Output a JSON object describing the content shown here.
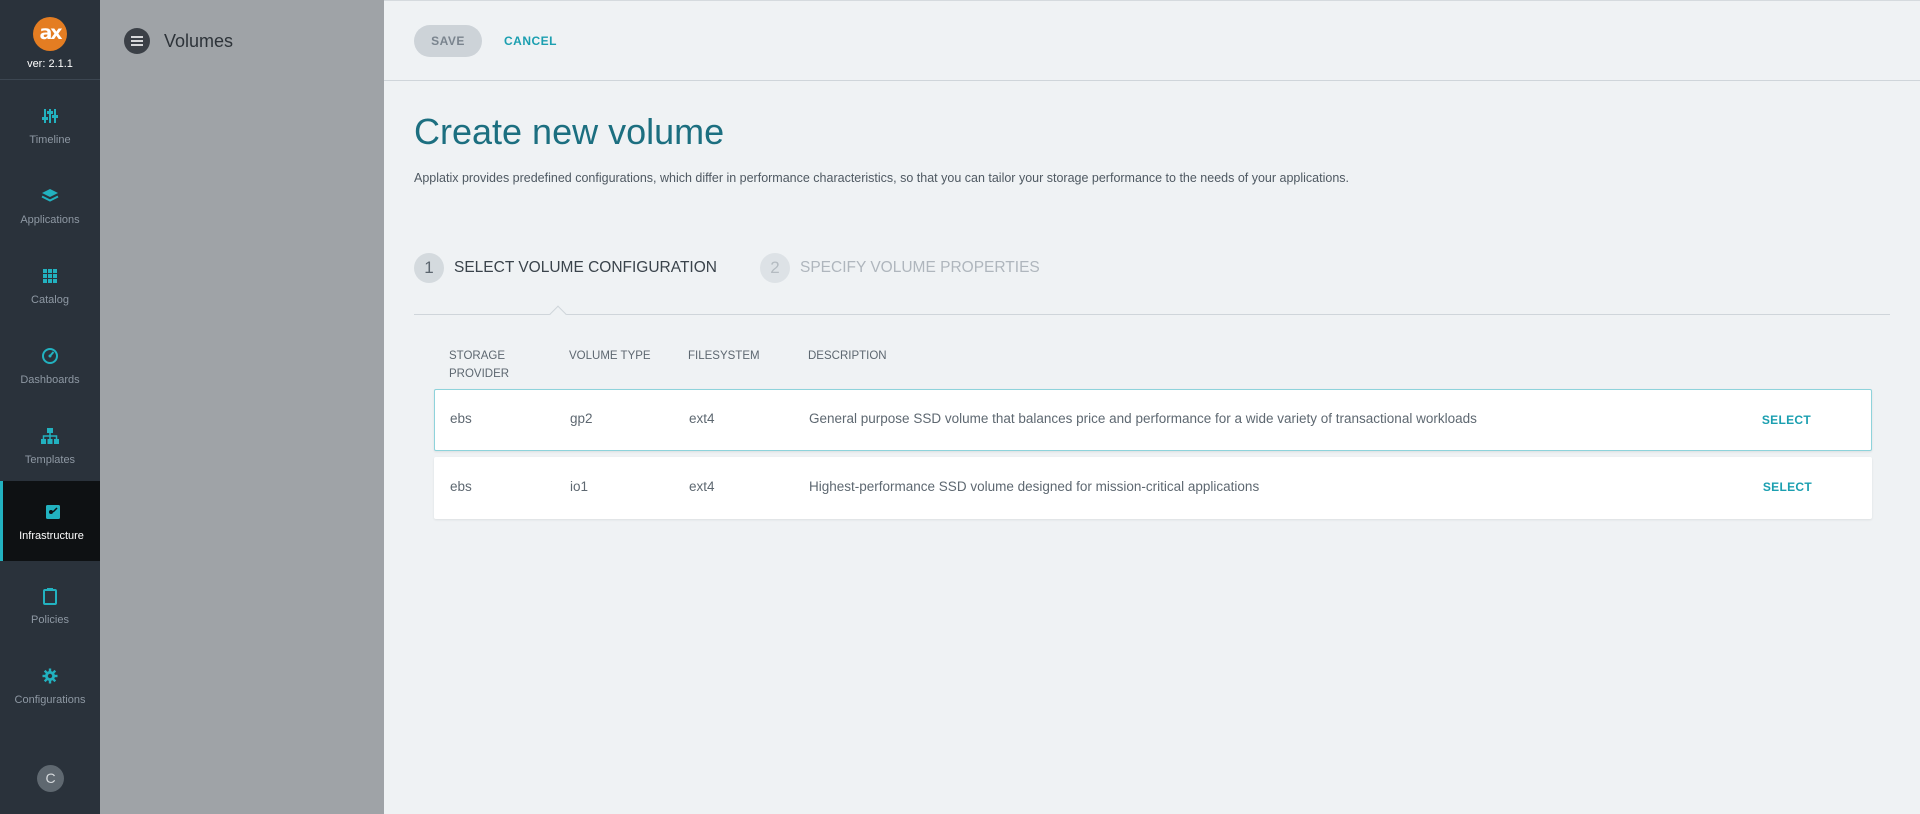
{
  "app": {
    "logo_text": "ax",
    "version": "ver: 2.1.1",
    "accent_color": "#22b2c0",
    "logo_color": "#e47d22"
  },
  "nav": {
    "items": [
      {
        "label": "Timeline",
        "icon": "sliders-icon"
      },
      {
        "label": "Applications",
        "icon": "layers-icon"
      },
      {
        "label": "Catalog",
        "icon": "grid-icon"
      },
      {
        "label": "Dashboards",
        "icon": "gauge-icon"
      },
      {
        "label": "Templates",
        "icon": "sitemap-icon"
      },
      {
        "label": "Infrastructure",
        "icon": "server-icon",
        "active": true
      },
      {
        "label": "Policies",
        "icon": "clipboard-icon"
      },
      {
        "label": "Configurations",
        "icon": "gear-icon"
      }
    ],
    "user_initial": "C"
  },
  "panel": {
    "title": "Volumes"
  },
  "toolbar": {
    "save_label": "SAVE",
    "cancel_label": "CANCEL"
  },
  "page": {
    "title": "Create new volume",
    "description": "Applatix provides predefined configurations, which differ in performance characteristics, so that you can tailor your storage performance to the needs of your applications."
  },
  "steps": [
    {
      "number": "1",
      "label": "SELECT VOLUME CONFIGURATION",
      "active": true
    },
    {
      "number": "2",
      "label": "SPECIFY VOLUME PROPERTIES",
      "active": false
    }
  ],
  "table": {
    "headers": {
      "provider_line1": "STORAGE",
      "provider_line2": "PROVIDER",
      "volume_type": "VOLUME TYPE",
      "filesystem": "FILESYSTEM",
      "description": "DESCRIPTION"
    },
    "rows": [
      {
        "provider": "ebs",
        "volume_type": "gp2",
        "filesystem": "ext4",
        "description": "General purpose SSD volume that balances price and performance for a wide variety of transactional workloads",
        "action": "SELECT"
      },
      {
        "provider": "ebs",
        "volume_type": "io1",
        "filesystem": "ext4",
        "description": "Highest-performance SSD volume designed for mission-critical applications",
        "action": "SELECT"
      }
    ]
  }
}
